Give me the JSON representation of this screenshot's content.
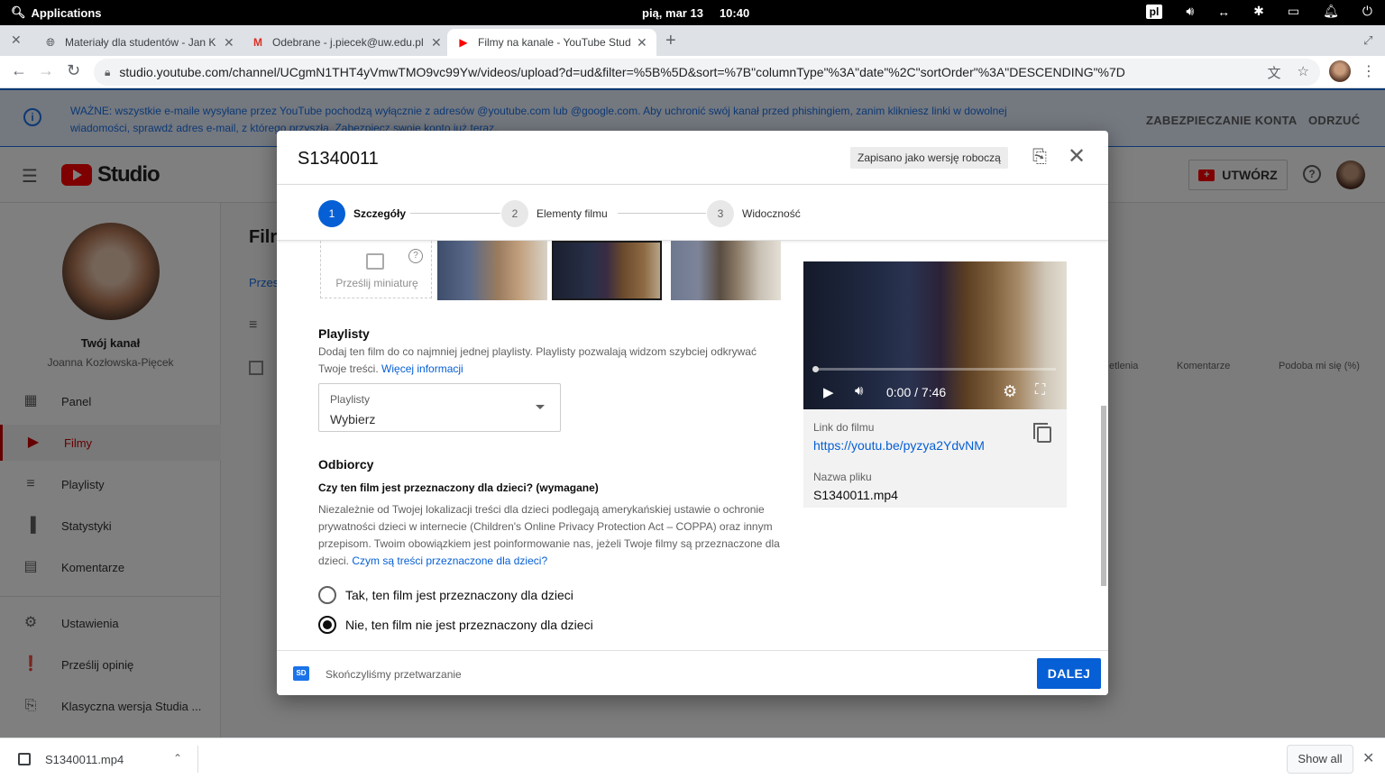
{
  "topbar": {
    "applications": "Applications",
    "date": "pią, mar 13",
    "time": "10:40",
    "lang": "pl"
  },
  "tabs": [
    {
      "title": "Materiały dla studentów - Jan K",
      "favicon": "globe-icon"
    },
    {
      "title": "Odebrane - j.piecek@uw.edu.pl",
      "favicon": "gmail-icon"
    },
    {
      "title": "Filmy na kanale - YouTube Studi",
      "favicon": "youtube-icon"
    }
  ],
  "address": {
    "url": "studio.youtube.com/channel/UCgmN1THT4yVmwTMO9vc99Yw/videos/upload?d=ud&filter=%5B%5D&sort=%7B\"columnType\"%3A\"date\"%2C\"sortOrder\"%3A\"DESCENDING\"%7D"
  },
  "banner": {
    "message": "WAŻNE: wszystkie e-maile wysyłane przez YouTube pochodzą wyłącznie z adresów @youtube.com lub @google.com. Aby uchronić swój kanał przed phishingiem, zanim klikniesz linki w dowolnej wiadomości, sprawdź adres e-mail, z którego przyszła. Zabezpiecz swoje konto już teraz.",
    "secure_label": "ZABEZPIECZANIE KONTA",
    "dismiss_label": "ODRZUĆ"
  },
  "studio": {
    "logo_text": "Studio",
    "create_label": "UTWÓRZ",
    "channel_name": "Twój kanał",
    "channel_owner": "Joanna Kozłowska-Pięcek",
    "nav": [
      {
        "label": "Panel",
        "icon": "dashboard-icon"
      },
      {
        "label": "Filmy",
        "icon": "videos-icon"
      },
      {
        "label": "Playlisty",
        "icon": "playlist-icon"
      },
      {
        "label": "Statystyki",
        "icon": "analytics-icon"
      },
      {
        "label": "Komentarze",
        "icon": "comments-icon"
      },
      {
        "label": "Ustawienia",
        "icon": "settings-icon"
      },
      {
        "label": "Prześlij opinię",
        "icon": "feedback-icon"
      },
      {
        "label": "Klasyczna wersja Studia ...",
        "icon": "classic-studio-icon"
      }
    ],
    "page_title": "Filr",
    "page_tab": "Przes",
    "col_views": "etlenia",
    "col_comments": "Komentarze",
    "col_likes": "Podoba mi się (%)"
  },
  "dialog": {
    "title": "S1340011",
    "draft_badge": "Zapisano jako wersję roboczą",
    "steps": [
      {
        "num": "1",
        "label": "Szczegóły"
      },
      {
        "num": "2",
        "label": "Elementy filmu"
      },
      {
        "num": "3",
        "label": "Widoczność"
      }
    ],
    "upload_thumb_label": "Prześlij miniaturę",
    "playlists": {
      "title": "Playlisty",
      "desc": "Dodaj ten film do co najmniej jednej playlisty. Playlisty pozwalają widzom szybciej odkrywać Twoje treści.",
      "more_link": "Więcej informacji",
      "select_label": "Playlisty",
      "select_value": "Wybierz"
    },
    "audience": {
      "title": "Odbiorcy",
      "question": "Czy ten film jest przeznaczony dla dzieci? (wymagane)",
      "desc": "Niezależnie od Twojej lokalizacji treści dla dzieci podlegają amerykańskiej ustawie o ochronie prywatności dzieci w internecie (Children's Online Privacy Protection Act – COPPA) oraz innym przepisom. Twoim obowiązkiem jest poinformowanie nas, jeżeli Twoje filmy są przeznaczone dla dzieci.",
      "desc_link": "Czym są treści przeznaczone dla dzieci?",
      "option_yes": "Tak, ten film jest przeznaczony dla dzieci",
      "option_no": "Nie, ten film nie jest przeznaczony dla dzieci"
    },
    "preview": {
      "time": "0:00 / 7:46",
      "link_label": "Link do filmu",
      "link_value": "https://youtu.be/pyzya2YdvNM",
      "file_label": "Nazwa pliku",
      "file_value": "S1340011.mp4"
    },
    "footer": {
      "sd_badge": "SD",
      "status": "Skończyliśmy przetwarzanie",
      "next_label": "DALEJ"
    }
  },
  "download": {
    "file": "S1340011.mp4",
    "show_all": "Show all"
  }
}
